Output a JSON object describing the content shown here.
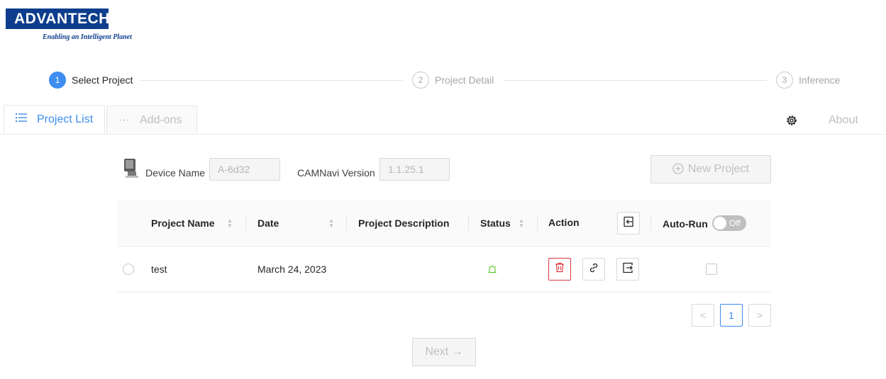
{
  "brand": {
    "name": "ADVANTECH",
    "tagline": "Enabling an Intelligent Planet",
    "color": "#0d3d8c"
  },
  "steps": [
    {
      "num": "1",
      "label": "Select Project"
    },
    {
      "num": "2",
      "label": "Project Detail"
    },
    {
      "num": "3",
      "label": "Inference"
    }
  ],
  "tabs": [
    {
      "label": "Project List",
      "icon": "list-icon"
    },
    {
      "label": "Add-ons",
      "icon": "ellipsis-icon"
    }
  ],
  "header": {
    "settings_icon": "gear-icon",
    "about_label": "About"
  },
  "device": {
    "name_label": "Device Name",
    "name_value": "A-6d32",
    "version_label": "CAMNavi Version",
    "version_value": "1.1.25.1",
    "new_project_label": "New Project"
  },
  "table": {
    "columns": {
      "name": "Project Name",
      "date": "Date",
      "description": "Project Description",
      "status": "Status",
      "action": "Action",
      "autorun": "Auto-Run"
    },
    "autorun_toggle": "Off",
    "rows": [
      {
        "name": "test",
        "date": "March 24, 2023",
        "description": "",
        "status_icon": "alarm-icon"
      }
    ]
  },
  "pagination": {
    "current": "1",
    "prev": "<",
    "next": ">"
  },
  "footer": {
    "next_label": "Next →"
  },
  "colors": {
    "accent": "#3d8ef0",
    "danger": "#d9363e",
    "status_ok": "#52c41a"
  }
}
